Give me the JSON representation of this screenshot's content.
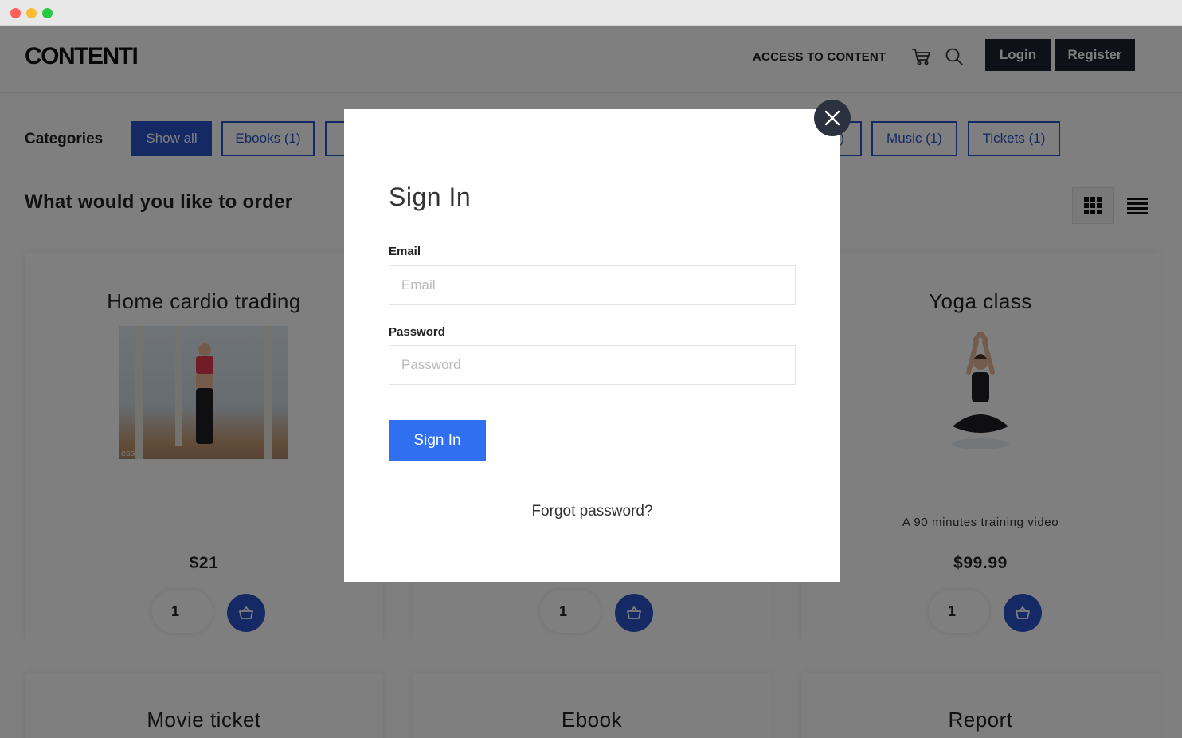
{
  "header": {
    "logo": "CONTENTI",
    "nav_link": "ACCESS TO CONTENT",
    "login_label": "Login",
    "register_label": "Register"
  },
  "categories": {
    "label": "Categories",
    "items": [
      {
        "label": "Show all",
        "active": true
      },
      {
        "label": "Ebooks (1)",
        "active": false
      },
      {
        "label": "",
        "active": false
      },
      {
        "label": ")",
        "active": false
      },
      {
        "label": "Music (1)",
        "active": false
      },
      {
        "label": "Tickets (1)",
        "active": false
      }
    ]
  },
  "main": {
    "title": "What would you like to order"
  },
  "products": [
    {
      "title": "Home cardio trading",
      "price": "$21",
      "qty": "1",
      "image_caption": "ess"
    },
    {
      "title": "",
      "price": "",
      "qty": "1"
    },
    {
      "title": "Yoga class",
      "description": "A 90 minutes training video",
      "price": "$99.99",
      "qty": "1"
    },
    {
      "title": "Movie ticket"
    },
    {
      "title": "Ebook"
    },
    {
      "title": "Report"
    }
  ],
  "modal": {
    "title": "Sign In",
    "email_label": "Email",
    "email_placeholder": "Email",
    "password_label": "Password",
    "password_placeholder": "Password",
    "submit_label": "Sign In",
    "forgot_label": "Forgot password?"
  },
  "colors": {
    "accent": "#2b55c9",
    "signin_button": "#2f6ff0",
    "header_button": "#1c2230",
    "overlay": "rgba(0,0,0,0.5)"
  },
  "icons": [
    "cart-icon",
    "search-icon",
    "grid-view-icon",
    "list-view-icon",
    "basket-icon",
    "close-icon"
  ]
}
